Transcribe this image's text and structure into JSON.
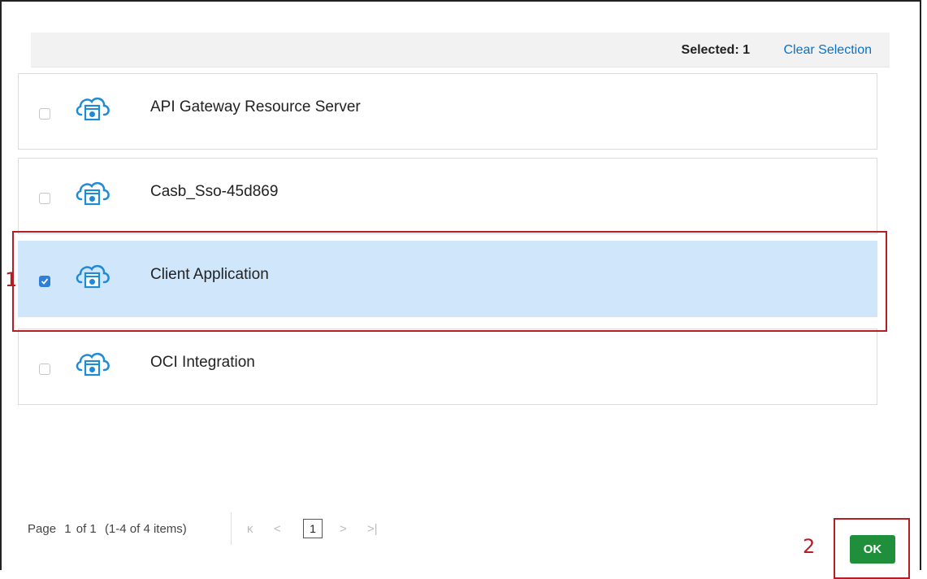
{
  "selection_bar": {
    "selected_text": "Selected: 1",
    "clear_label": "Clear Selection"
  },
  "apps": [
    {
      "name": "API Gateway Resource Server",
      "checked": false
    },
    {
      "name": "Casb_Sso-45d869",
      "checked": false
    },
    {
      "name": "Client Application",
      "checked": true
    },
    {
      "name": "OCI Integration",
      "checked": false
    }
  ],
  "pager": {
    "label": "Page",
    "current": "1",
    "of_text": "of 1",
    "items_text": "(1-4 of 4 items)",
    "first_icon": "first-page-icon",
    "prev_icon": "prev-page-icon",
    "next_icon": "next-page-icon",
    "last_icon": "last-page-icon"
  },
  "ok_label": "OK",
  "annotations": [
    "1",
    "2"
  ],
  "colors": {
    "accent": "#0572ce",
    "selected_row": "#d0e6fb",
    "ok": "#1f8f3b",
    "annotation": "#b41e24"
  }
}
